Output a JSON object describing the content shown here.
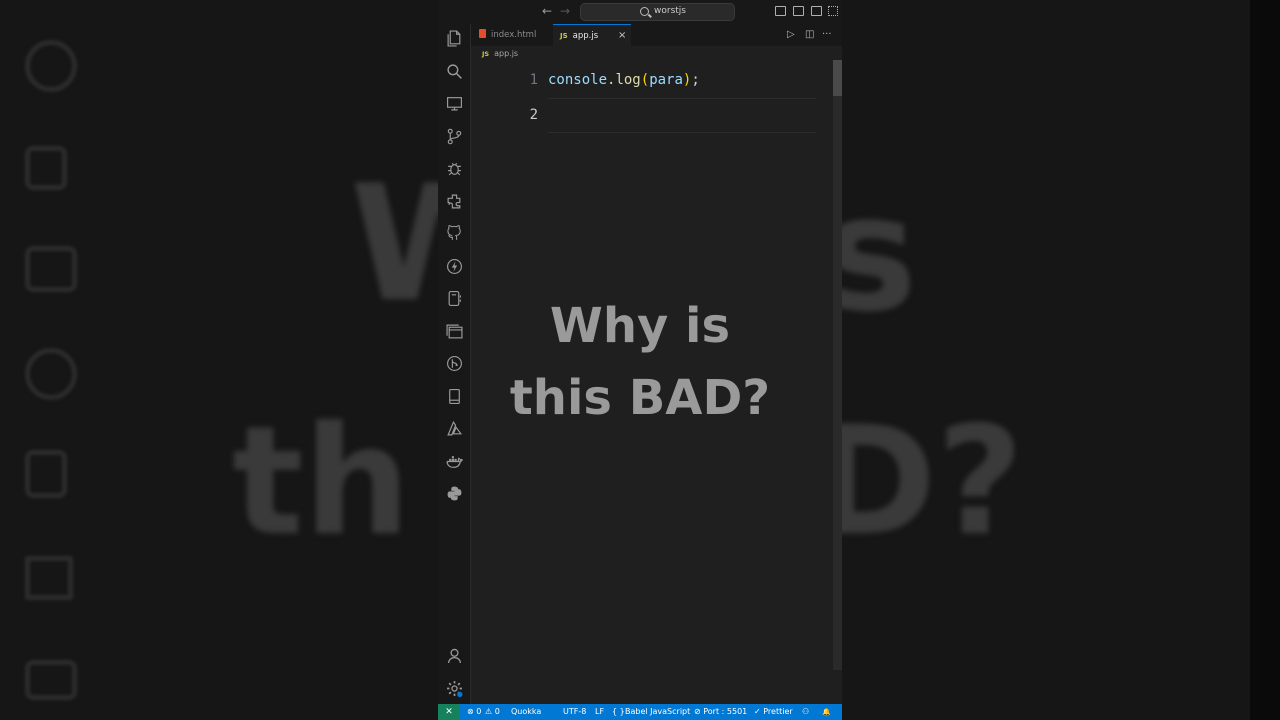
{
  "background_overlay_text": {
    "line1": "Why is",
    "line2": "this BAD?"
  },
  "titlebar": {
    "back": "←",
    "forward": "→",
    "search_label": "worstjs"
  },
  "tabs": [
    {
      "label": "index.html",
      "active": false,
      "icon": "html5-icon"
    },
    {
      "label": "app.js",
      "active": true,
      "icon": "js-icon",
      "close": "×"
    }
  ],
  "tab_icons": {
    "js": "JS"
  },
  "breadcrumb": {
    "badge": "JS",
    "file": "app.js"
  },
  "editor": {
    "lines": [
      {
        "number": "1",
        "tokens": [
          "console",
          ".",
          "log",
          "(",
          "para",
          ")",
          ";"
        ]
      },
      {
        "number": "2",
        "tokens": []
      }
    ]
  },
  "overlay": {
    "line1": "Why is",
    "line2": "this BAD?"
  },
  "statusbar": {
    "remote": "✕",
    "errors": "⊗ 0",
    "warnings": "⚠ 0",
    "quokka": "Quokka",
    "encoding": "UTF-8",
    "eol": "LF",
    "language_icon": "{ }",
    "language": "Babel JavaScript",
    "port": "⊘ Port : 5501",
    "prettier": "✓ Prettier",
    "copilot": "⚇",
    "bell": "🔔"
  },
  "colors": {
    "status_bar": "#0078d4",
    "remote": "#16825d",
    "active_tab_border": "#0078d4"
  }
}
